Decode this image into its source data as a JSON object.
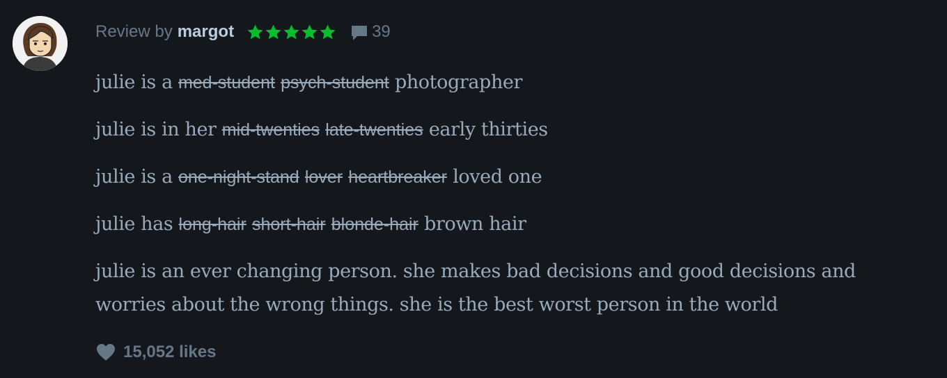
{
  "review": {
    "byline": "Review by",
    "author": "margot",
    "rating_stars": 5,
    "star_color": "#00c030",
    "comment_count": "39",
    "lines": [
      {
        "prefix": "julie is a",
        "struck": [
          "med-student",
          "psych-student"
        ],
        "suffix": "photographer"
      },
      {
        "prefix": "julie is in her",
        "struck": [
          "mid-twenties",
          "late-twenties"
        ],
        "suffix": "early thirties"
      },
      {
        "prefix": "julie is a",
        "struck": [
          "one-night-stand",
          "lover",
          "heartbreaker"
        ],
        "suffix": "loved one"
      },
      {
        "prefix": "julie has",
        "struck": [
          "long-hair",
          "short-hair",
          "blonde-hair"
        ],
        "suffix": "brown hair"
      }
    ],
    "closing": "julie is an ever changing person. she makes bad decisions and good decisions and worries about the wrong things. she is the best worst person in the world",
    "likes": "15,052 likes"
  },
  "icons": {
    "comment": "speech-bubble-icon",
    "like": "heart-icon",
    "star": "star-icon"
  }
}
